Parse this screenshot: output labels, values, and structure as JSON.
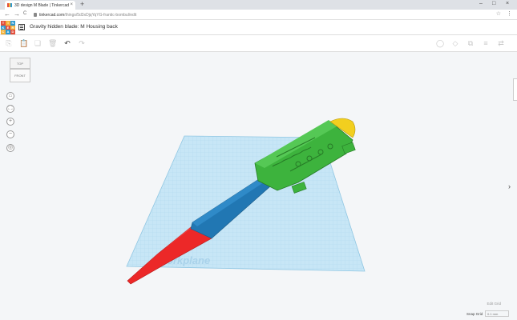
{
  "browser": {
    "tab_title": "3D design M Blade | Tinkercad",
    "tab_close": "×",
    "new_tab": "+",
    "back": "←",
    "forward": "→",
    "reload": "C",
    "url_host": "tinkercad.com",
    "url_path": "/things/5d3xDjqYqYG-frantic-bombul/edit",
    "star": "☆",
    "menu": "⋮",
    "win_min": "–",
    "win_max": "□",
    "win_close": "×"
  },
  "app": {
    "logo_letters": [
      "TIN",
      "",
      "",
      "KER",
      "",
      "",
      "CAD",
      "",
      ""
    ],
    "design_title": "Gravity hidden blade: M Housing back"
  },
  "toolbar": {
    "copy": "⎘",
    "paste": "📋",
    "duplicate": "❏",
    "delete": "🗑",
    "undo": "↶",
    "redo": "↷",
    "light": "◯",
    "shape": "◇",
    "group": "⧉",
    "align": "≡",
    "mirror": "⇄"
  },
  "viewcube": {
    "top": "TOP",
    "front": "FRONT"
  },
  "view_controls": {
    "home": "⌂",
    "fit": "⛶",
    "zoom_in": "+",
    "zoom_out": "−",
    "ortho": "◎"
  },
  "workplane": {
    "watermark": "orkplane",
    "grid_color": "#a9d6ee",
    "plane_color": "#c7e6f6"
  },
  "model": {
    "handle_color": "#ec2828",
    "blade_color": "#2177b3",
    "housing_color": "#3db33d",
    "cap_color": "#f2cf1f"
  },
  "footer": {
    "edit_grid": "Edit Grid",
    "snap_label": "Snap Grid",
    "snap_value": "0.1 mm"
  },
  "side": {
    "expand_arrow": "›"
  }
}
